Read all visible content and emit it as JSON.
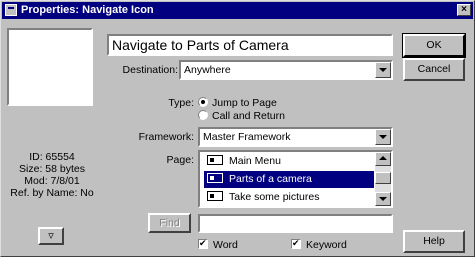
{
  "window": {
    "title": "Properties: Navigate Icon",
    "close_label": "×"
  },
  "icon_info": {
    "id": "ID: 65554",
    "size": "Size: 58 bytes",
    "mod": "Mod: 7/8/01",
    "ref": "Ref. by Name: No"
  },
  "icon_button_glyph": "▿",
  "name_value": "Navigate to Parts of Camera",
  "destination": {
    "label": "Destination:",
    "value": "Anywhere"
  },
  "type": {
    "label": "Type:",
    "options": [
      "Jump to Page",
      "Call and Return"
    ],
    "selected_index": 0
  },
  "framework": {
    "label": "Framework:",
    "value": "Master Framework"
  },
  "page": {
    "label": "Page:",
    "items": [
      "Main Menu",
      "Parts of a camera",
      "Take some pictures"
    ],
    "selected_index": 1
  },
  "find": {
    "button_label": "Find",
    "value": ""
  },
  "options": {
    "word": "Word",
    "keyword": "Keyword",
    "word_checked": true,
    "keyword_checked": true
  },
  "buttons": {
    "ok": "OK",
    "cancel": "Cancel",
    "help": "Help"
  }
}
